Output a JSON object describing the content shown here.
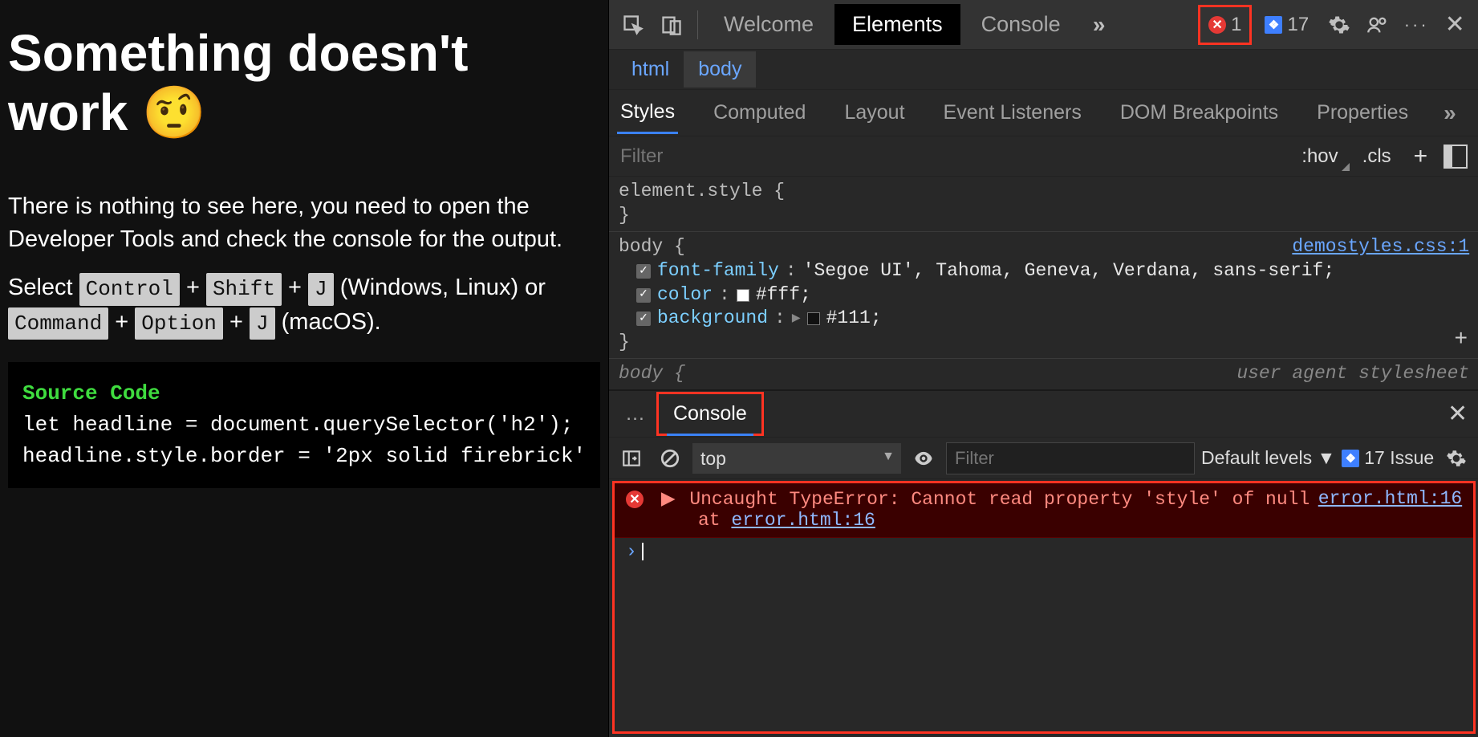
{
  "page": {
    "heading": "Something doesn't work 🤨",
    "para1": "There is nothing to see here, you need to open the Developer Tools and check the console for the output.",
    "select_text": "Select ",
    "kbd_ctrl": "Control",
    "plus": " + ",
    "kbd_shift": "Shift",
    "kbd_j": "J",
    "windows_linux": " (Windows, Linux) or ",
    "kbd_cmd": "Command",
    "kbd_opt": "Option",
    "macos": " (macOS).",
    "code_title": "Source Code",
    "code_line1": "let headline = document.querySelector('h2');",
    "code_line2": "headline.style.border = '2px solid firebrick'"
  },
  "devtools": {
    "tabs": {
      "welcome": "Welcome",
      "elements": "Elements",
      "console": "Console"
    },
    "errors_count": "1",
    "issues_count": "17",
    "breadcrumb": {
      "html": "html",
      "body": "body"
    },
    "subtabs": {
      "styles": "Styles",
      "computed": "Computed",
      "layout": "Layout",
      "event_listeners": "Event Listeners",
      "dom_breakpoints": "DOM Breakpoints",
      "properties": "Properties"
    },
    "filter_placeholder": "Filter",
    "hov": ":hov",
    "cls": ".cls",
    "rules": {
      "element_style_sel": "element.style {",
      "element_style_close": "}",
      "body_sel": "body {",
      "body_close": "}",
      "body_link": "demostyles.css:1",
      "decl1_prop": "font-family",
      "decl1_val": "'Segoe UI', Tahoma, Geneva, Verdana, sans-serif;",
      "decl2_prop": "color",
      "decl2_val": "#fff;",
      "decl3_prop": "background",
      "decl3_val": "#111;",
      "ua_body_sel": "body {",
      "ua_label": "user agent stylesheet"
    }
  },
  "drawer": {
    "console_tab": "Console",
    "context": "top",
    "filter_placeholder": "Filter",
    "levels": "Default levels ▼",
    "issues_label": "17 Issue",
    "error_msg": "Uncaught TypeError: Cannot read property 'style' of null",
    "error_loc": "error.html:16",
    "error_at_prefix": "at ",
    "error_at_link": "error.html:16",
    "prompt": "›"
  }
}
